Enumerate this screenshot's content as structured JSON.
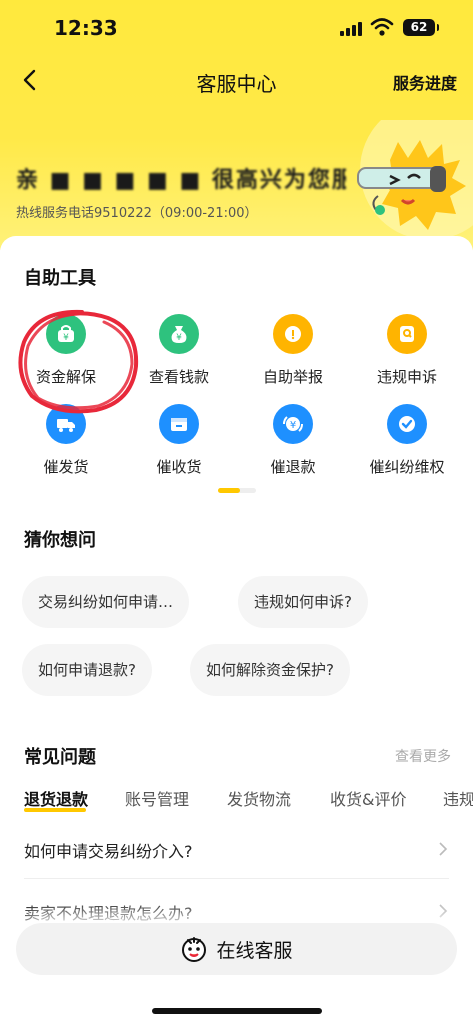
{
  "status_bar": {
    "time": "12:33",
    "battery": "62"
  },
  "nav": {
    "title": "客服中心",
    "progress": "服务进度"
  },
  "banner": {
    "title_blurred": "亲 ■ ■ ■ ■ ■ 很高兴为您服务",
    "hotline": "热线服务电话9510222（09:00-21:00）"
  },
  "tools": {
    "title": "自助工具",
    "items": [
      {
        "label": "资金解保",
        "icon": "fund-unlock-icon",
        "color": "#2ec27e",
        "glyph": "¥"
      },
      {
        "label": "查看钱款",
        "icon": "money-bag-icon",
        "color": "#2ec27e",
        "glyph": "¥"
      },
      {
        "label": "自助举报",
        "icon": "report-icon",
        "color": "#ffb400",
        "glyph": "!"
      },
      {
        "label": "违规申诉",
        "icon": "appeal-icon",
        "color": "#ffb400",
        "glyph": "Q"
      },
      {
        "label": "催发货",
        "icon": "truck-icon",
        "color": "#1e90ff",
        "glyph": ""
      },
      {
        "label": "催收货",
        "icon": "package-icon",
        "color": "#1e90ff",
        "glyph": ""
      },
      {
        "label": "催退款",
        "icon": "refund-icon",
        "color": "#1e90ff",
        "glyph": "¥"
      },
      {
        "label": "催纠纷维权",
        "icon": "check-shield-icon",
        "color": "#1e90ff",
        "glyph": "✓"
      }
    ]
  },
  "guess": {
    "title": "猜你想问",
    "chips": [
      "交易纠纷如何申请…",
      "违规如何申诉?",
      "如何申请退款?",
      "如何解除资金保护?"
    ]
  },
  "faq": {
    "title": "常见问题",
    "see_more": "查看更多",
    "tabs": [
      "退货退款",
      "账号管理",
      "发货物流",
      "收货&评价",
      "违规"
    ],
    "questions": [
      "如何申请交易纠纷介入?",
      "卖家不处理退款怎么办?"
    ]
  },
  "service_button": {
    "label": "在线客服"
  },
  "colors": {
    "brand_yellow": "#ffe93d",
    "accent": "#ffc800",
    "annotation_red": "#e8283a"
  }
}
